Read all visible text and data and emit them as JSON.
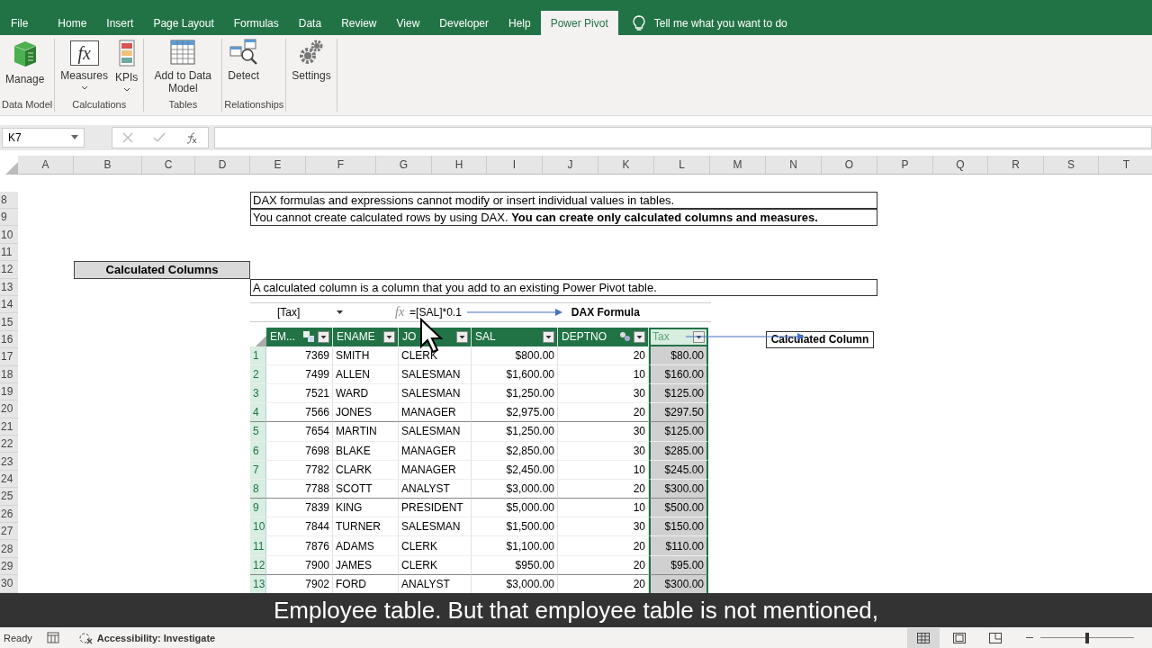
{
  "ribbon_tabs": [
    {
      "label": "File",
      "selected": false
    },
    {
      "label": "Home",
      "selected": false
    },
    {
      "label": "Insert",
      "selected": false
    },
    {
      "label": "Page Layout",
      "selected": false
    },
    {
      "label": "Formulas",
      "selected": false
    },
    {
      "label": "Data",
      "selected": false
    },
    {
      "label": "Review",
      "selected": false
    },
    {
      "label": "View",
      "selected": false
    },
    {
      "label": "Developer",
      "selected": false
    },
    {
      "label": "Help",
      "selected": false
    },
    {
      "label": "Power Pivot",
      "selected": true
    }
  ],
  "tell_me": "Tell me what you want to do",
  "ribbon_groups": [
    {
      "label": "Data Model",
      "commands": [
        {
          "label": "Manage",
          "kind": "manage",
          "dropdown": false
        }
      ]
    },
    {
      "label": "Calculations",
      "commands": [
        {
          "label": "Measures",
          "kind": "measures",
          "glyph": "fx",
          "dropdown": true
        },
        {
          "label": "KPIs",
          "kind": "kpis",
          "dropdown": true
        }
      ]
    },
    {
      "label": "Tables",
      "commands": [
        {
          "label": "Add to Data Model",
          "kind": "table",
          "dropdown": false
        }
      ]
    },
    {
      "label": "Relationships",
      "commands": [
        {
          "label": "Detect",
          "kind": "detect",
          "dropdown": false
        }
      ]
    },
    {
      "commands": [
        {
          "label": "Settings",
          "kind": "settings",
          "dropdown": false
        }
      ]
    }
  ],
  "name_box": "K7",
  "column_headers": [
    "A",
    "B",
    "C",
    "D",
    "E",
    "F",
    "G",
    "H",
    "I",
    "J",
    "K",
    "L",
    "M",
    "N",
    "O",
    "P",
    "Q",
    "R",
    "S",
    "T"
  ],
  "row_headers": [
    "8",
    "9",
    "10",
    "11",
    "12",
    "13",
    "14",
    "15",
    "16",
    "17",
    "18",
    "19",
    "20",
    "21",
    "22",
    "23",
    "24",
    "25",
    "26",
    "27",
    "28",
    "29",
    "30"
  ],
  "cells": [
    {
      "kind": "boxed",
      "text": "DAX formulas and expressions cannot modify or insert individual values in tables."
    },
    {
      "kind": "boxed",
      "text": "You cannot create calculated rows by using DAX. **You can create only calculated columns and measures.**"
    },
    {
      "kind": "heading",
      "text": "Calculated Columns"
    },
    {
      "kind": "boxed",
      "text": "A calculated column is a column that you add to an existing Power Pivot table."
    },
    {
      "kind": "note",
      "text": "Calculated Column"
    }
  ],
  "power_pivot": {
    "column_box": "[Tax]",
    "fx_label": "fx",
    "formula": "=[SAL]*0.1",
    "formula_note": "DAX Formula",
    "columns": [
      {
        "label": "EM...",
        "kind": "key",
        "selected": false
      },
      {
        "label": "ENAME",
        "kind": "plain",
        "selected": false
      },
      {
        "label": "JO",
        "kind": "plain",
        "selected": false
      },
      {
        "label": "SAL",
        "kind": "plain",
        "selected": false
      },
      {
        "label": "DEPTNO",
        "kind": "relation",
        "selected": false
      },
      {
        "label": "Tax",
        "kind": "plain",
        "selected": true
      }
    ],
    "rows": [
      {
        "number": "1",
        "cells": [
          "7369",
          "SMITH",
          "CLERK",
          "$800.00",
          "20",
          "$80.00"
        ]
      },
      {
        "number": "2",
        "cells": [
          "7499",
          "ALLEN",
          "SALESMAN",
          "$1,600.00",
          "10",
          "$160.00"
        ]
      },
      {
        "number": "3",
        "cells": [
          "7521",
          "WARD",
          "SALESMAN",
          "$1,250.00",
          "30",
          "$125.00"
        ]
      },
      {
        "number": "4",
        "cells": [
          "7566",
          "JONES",
          "MANAGER",
          "$2,975.00",
          "20",
          "$297.50"
        ]
      },
      {
        "number": "5",
        "cells": [
          "7654",
          "MARTIN",
          "SALESMAN",
          "$1,250.00",
          "30",
          "$125.00"
        ]
      },
      {
        "number": "6",
        "cells": [
          "7698",
          "BLAKE",
          "MANAGER",
          "$2,850.00",
          "30",
          "$285.00"
        ]
      },
      {
        "number": "7",
        "cells": [
          "7782",
          "CLARK",
          "MANAGER",
          "$2,450.00",
          "10",
          "$245.00"
        ]
      },
      {
        "number": "8",
        "cells": [
          "7788",
          "SCOTT",
          "ANALYST",
          "$3,000.00",
          "20",
          "$300.00"
        ]
      },
      {
        "number": "9",
        "cells": [
          "7839",
          "KING",
          "PRESIDENT",
          "$5,000.00",
          "10",
          "$500.00"
        ]
      },
      {
        "number": "10",
        "cells": [
          "7844",
          "TURNER",
          "SALESMAN",
          "$1,500.00",
          "30",
          "$150.00"
        ]
      },
      {
        "number": "11",
        "cells": [
          "7876",
          "ADAMS",
          "CLERK",
          "$1,100.00",
          "20",
          "$110.00"
        ]
      },
      {
        "number": "12",
        "cells": [
          "7900",
          "JAMES",
          "CLERK",
          "$950.00",
          "20",
          "$95.00"
        ]
      },
      {
        "number": "13",
        "cells": [
          "7902",
          "FORD",
          "ANALYST",
          "$3,000.00",
          "20",
          "$300.00"
        ]
      }
    ]
  },
  "caption": "Employee table. But that employee table is not mentioned,",
  "status": {
    "ready": "Ready",
    "accessibility": "Accessibility: Investigate",
    "views": [
      {
        "kind": "normal",
        "selected": true
      },
      {
        "kind": "page_layout",
        "selected": false
      },
      {
        "kind": "page_break",
        "selected": false
      }
    ],
    "zoom": {
      "level": 0.5
    }
  }
}
